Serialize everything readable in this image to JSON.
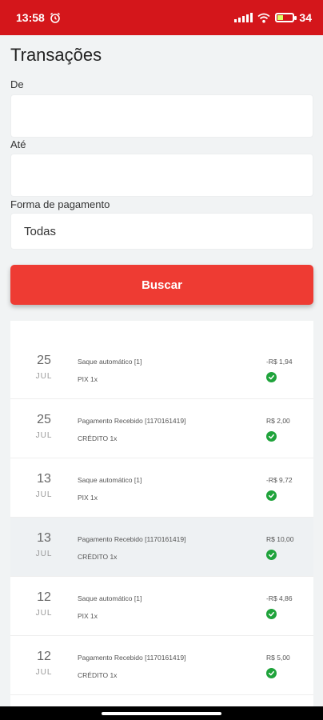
{
  "status_bar": {
    "time": "13:58",
    "battery": "34",
    "battery_level": 0.34
  },
  "page": {
    "title": "Transações"
  },
  "filters": {
    "from_label": "De",
    "from_value": "",
    "to_label": "Até",
    "to_value": "",
    "payment_label": "Forma de pagamento",
    "payment_value": "Todas"
  },
  "search_button": {
    "label": "Buscar"
  },
  "transactions": [
    {
      "day": "25",
      "month": "JUL",
      "description": "Saque automático [1]",
      "method": "PIX 1x",
      "amount": "-R$ 1,94",
      "status_icon": "check-circle-icon"
    },
    {
      "day": "25",
      "month": "JUL",
      "description": "Pagamento Recebido [1170161419]",
      "method": "CRÉDITO 1x",
      "amount": "R$ 2,00",
      "status_icon": "check-circle-icon"
    },
    {
      "day": "13",
      "month": "JUL",
      "description": "Saque automático [1]",
      "method": "PIX 1x",
      "amount": "-R$ 9,72",
      "status_icon": "check-circle-icon"
    },
    {
      "day": "13",
      "month": "JUL",
      "description": "Pagamento Recebido [1170161419]",
      "method": "CRÉDITO 1x",
      "amount": "R$ 10,00",
      "status_icon": "check-circle-icon"
    },
    {
      "day": "12",
      "month": "JUL",
      "description": "Saque automático [1]",
      "method": "PIX 1x",
      "amount": "-R$ 4,86",
      "status_icon": "check-circle-icon"
    },
    {
      "day": "12",
      "month": "JUL",
      "description": "Pagamento Recebido [1170161419]",
      "method": "CRÉDITO 1x",
      "amount": "R$ 5,00",
      "status_icon": "check-circle-icon"
    }
  ],
  "colors": {
    "status_bar": "#d4161b",
    "primary_button": "#ee3b33",
    "success": "#1fa33b"
  }
}
